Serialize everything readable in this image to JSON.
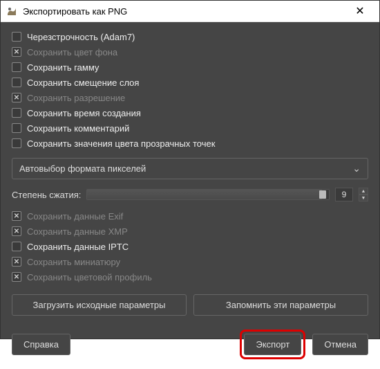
{
  "window": {
    "title": "Экспортировать как PNG"
  },
  "options": [
    {
      "label": "Черезстрочность (Adam7)",
      "checked": false,
      "gray": false
    },
    {
      "label": "Сохранить цвет фона",
      "checked": true,
      "gray": true
    },
    {
      "label": "Сохранить гамму",
      "checked": false,
      "gray": false
    },
    {
      "label": "Сохранить смещение слоя",
      "checked": false,
      "gray": false
    },
    {
      "label": "Сохранить разрешение",
      "checked": true,
      "gray": true
    },
    {
      "label": "Сохранить время создания",
      "checked": false,
      "gray": false
    },
    {
      "label": "Сохранить комментарий",
      "checked": false,
      "gray": false
    },
    {
      "label": "Сохранить значения цвета прозрачных точек",
      "checked": false,
      "gray": false
    }
  ],
  "dropdown": {
    "label": "Автовыбор формата пикселей"
  },
  "compression": {
    "label": "Степень сжатия:",
    "value": "9"
  },
  "options2": [
    {
      "label": "Сохранить данные Exif",
      "checked": true,
      "gray": true
    },
    {
      "label": "Сохранить данные XMP",
      "checked": true,
      "gray": true
    },
    {
      "label": "Сохранить данные IPTC",
      "checked": false,
      "gray": false
    },
    {
      "label": "Сохранить миниатюру",
      "checked": true,
      "gray": true
    },
    {
      "label": "Сохранить цветовой профиль",
      "checked": true,
      "gray": true
    }
  ],
  "buttons": {
    "load_defaults": "Загрузить исходные параметры",
    "save_defaults": "Запомнить эти параметры",
    "help": "Справка",
    "export": "Экспорт",
    "cancel": "Отмена"
  }
}
